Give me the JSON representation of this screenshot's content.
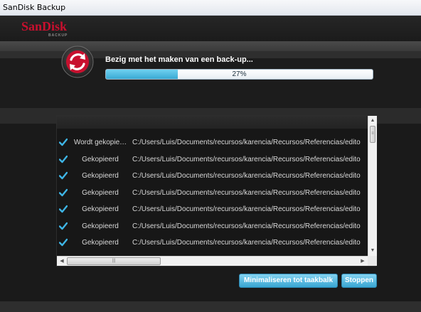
{
  "window": {
    "title": "SanDisk Backup"
  },
  "header": {
    "logo_text": "SanDisk",
    "logo_subtext": "BACKUP",
    "brand_color": "#c8102e"
  },
  "progress": {
    "icon": "sync-arrows-icon",
    "status": "Bezig met het maken van een back-up...",
    "percent_label": "27%",
    "value": 0.27,
    "fill_color": "#3aa9d4"
  },
  "file_list": {
    "check_color": "#3eb5e6",
    "rows": [
      {
        "status": "Wordt gekopie…",
        "path": "C:/Users/Luis/Documents/recursos/karencia/Recursos/Referencias/edito"
      },
      {
        "status": "Gekopieerd",
        "path": "C:/Users/Luis/Documents/recursos/karencia/Recursos/Referencias/edito"
      },
      {
        "status": "Gekopieerd",
        "path": "C:/Users/Luis/Documents/recursos/karencia/Recursos/Referencias/edito"
      },
      {
        "status": "Gekopieerd",
        "path": "C:/Users/Luis/Documents/recursos/karencia/Recursos/Referencias/edito"
      },
      {
        "status": "Gekopieerd",
        "path": "C:/Users/Luis/Documents/recursos/karencia/Recursos/Referencias/edito"
      },
      {
        "status": "Gekopieerd",
        "path": "C:/Users/Luis/Documents/recursos/karencia/Recursos/Referencias/edito"
      },
      {
        "status": "Gekopieerd",
        "path": "C:/Users/Luis/Documents/recursos/karencia/Recursos/Referencias/edito"
      }
    ]
  },
  "buttons": {
    "minimize_label": "Minimaliseren tot taakbalk",
    "stop_label": "Stoppen"
  }
}
